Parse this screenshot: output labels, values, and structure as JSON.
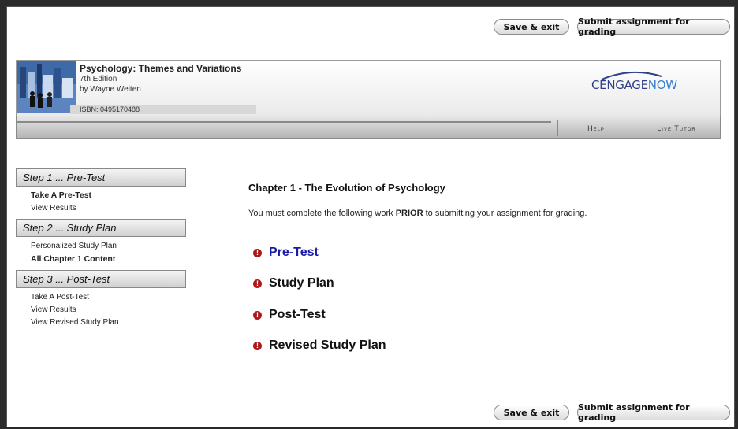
{
  "toolbar": {
    "save_exit_label": "Save & exit",
    "submit_label": "Submit assignment for grading"
  },
  "book": {
    "title": "Psychology: Themes and Variations",
    "edition": "7th Edition",
    "author": "by Wayne Weiten",
    "isbn": "ISBN: 0495170488"
  },
  "logo": {
    "part1": "CENGAGE",
    "part2": "NOW"
  },
  "tabs": {
    "help": "Help",
    "live_tutor": "Live Tutor"
  },
  "sidebar": {
    "step1": {
      "label": "Step 1 ... Pre-Test",
      "items": [
        "Take A Pre-Test",
        "View Results"
      ]
    },
    "step2": {
      "label": "Step 2 ... Study Plan",
      "items": [
        "Personalized Study Plan",
        "All Chapter 1 Content"
      ]
    },
    "step3": {
      "label": "Step 3 ... Post-Test",
      "items": [
        "Take A Post-Test",
        "View Results",
        "View Revised Study Plan"
      ]
    }
  },
  "main": {
    "chapter_title": "Chapter 1 - The Evolution of Psychology",
    "instruction_before": "You must complete the following work ",
    "instruction_bold": "PRIOR",
    "instruction_after": " to submitting your assignment for grading.",
    "tasks": [
      "Pre-Test",
      "Study Plan",
      "Post-Test",
      "Revised Study Plan"
    ],
    "alert_symbol": "!"
  },
  "colors": {
    "alert": "#b01818",
    "link": "#1a1aa6",
    "logo_dark": "#2f3f88",
    "logo_light": "#3b7fcc"
  }
}
